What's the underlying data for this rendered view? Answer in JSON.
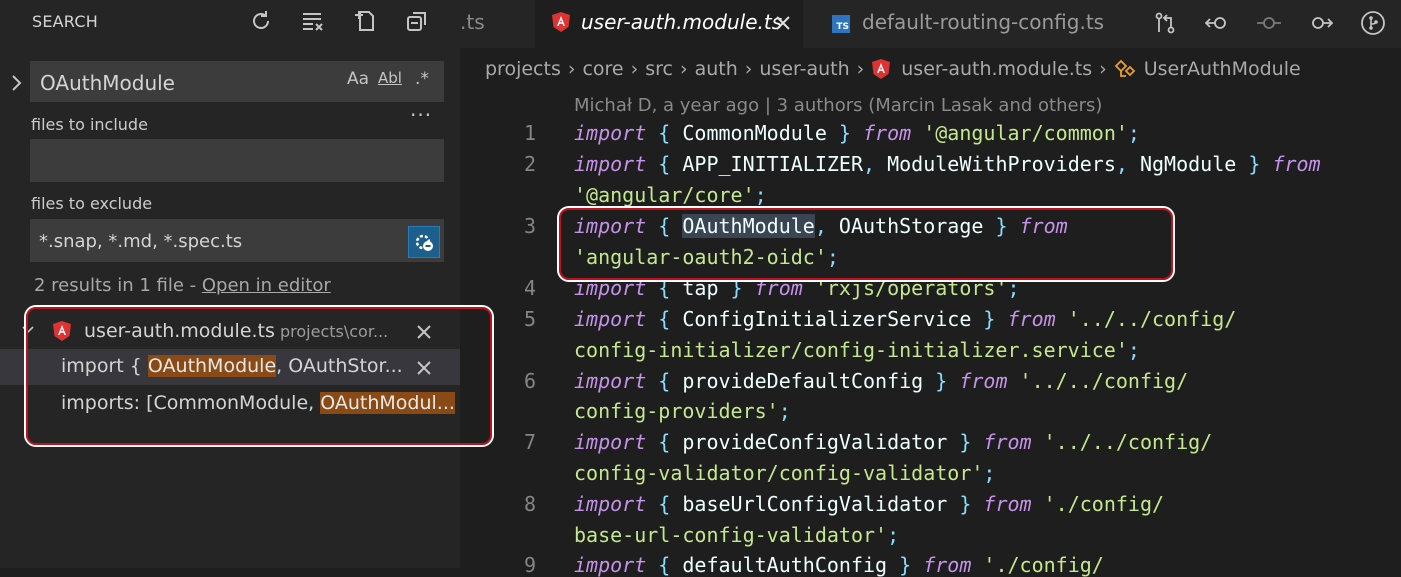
{
  "sidebar": {
    "title": "SEARCH",
    "search_query": "OAuthModule",
    "options": {
      "match_case": "Aa",
      "whole_word": "Abl",
      "regex": ".*"
    },
    "more": "···",
    "include_label": "files to include",
    "include_value": "",
    "exclude_label": "files to exclude",
    "exclude_value": "*.snap, *.md, *.spec.ts",
    "results_summary": "2 results in 1 file - ",
    "open_in_editor": "Open in editor",
    "file": {
      "name": "user-auth.module.ts",
      "path": "projects\\cor..."
    },
    "matches": [
      {
        "before": "import { ",
        "match": "OAuthModule",
        "after": ", OAuthStor..."
      },
      {
        "before": "imports: [CommonModule, ",
        "match": "OAuthModul...",
        "after": ""
      }
    ]
  },
  "tabs": [
    {
      "label": ".ts",
      "active": false
    },
    {
      "label": "user-auth.module.ts",
      "active": true
    },
    {
      "label": "default-routing-config.ts",
      "active": false
    }
  ],
  "breadcrumbs": [
    "projects",
    "core",
    "src",
    "auth",
    "user-auth",
    "user-auth.module.ts",
    "UserAuthModule"
  ],
  "blame": "Michał D, a year ago | 3 authors (Marcin Lasak and others)",
  "line_numbers": [
    "1",
    "2",
    "3",
    "4",
    "5",
    "6",
    "7",
    "8",
    "9"
  ],
  "code": {
    "l1": {
      "kw": "import",
      "open": " { ",
      "id": "CommonModule",
      "close": " } ",
      "from": "from",
      "str": " '@angular/common'",
      "semi": ";"
    },
    "l2": {
      "kw": "import",
      "open": " { ",
      "id": "APP_INITIALIZER",
      "c1": ", ",
      "id2": "ModuleWithProviders",
      "c2": ", ",
      "id3": "NgModule",
      "close": " } ",
      "from": "from"
    },
    "l2b": {
      "str": "'@angular/core'",
      "semi": ";"
    },
    "l3": {
      "kw": "import",
      "open": " { ",
      "id": "OAuthModule",
      "c1": ", ",
      "id2": "OAuthStorage",
      "close": " } ",
      "from": "from"
    },
    "l3b": {
      "str": "'angular-oauth2-oidc'",
      "semi": ";"
    },
    "l4": {
      "kw": "import",
      "open": " { ",
      "id": "tap",
      "close": " } ",
      "from": "from",
      "str": " 'rxjs/operators'",
      "semi": ";"
    },
    "l5": {
      "kw": "import",
      "open": " { ",
      "id": "ConfigInitializerService",
      "close": " } ",
      "from": "from",
      "str": " '../../config/"
    },
    "l5b": {
      "str": "config-initializer/config-initializer.service'",
      "semi": ";"
    },
    "l6": {
      "kw": "import",
      "open": " { ",
      "id": "provideDefaultConfig",
      "close": " } ",
      "from": "from",
      "str": " '../../config/"
    },
    "l6b": {
      "str": "config-providers'",
      "semi": ";"
    },
    "l7": {
      "kw": "import",
      "open": " { ",
      "id": "provideConfigValidator",
      "close": " } ",
      "from": "from",
      "str": " '../../config/"
    },
    "l7b": {
      "str": "config-validator/config-validator'",
      "semi": ";"
    },
    "l8": {
      "kw": "import",
      "open": " { ",
      "id": "baseUrlConfigValidator",
      "close": " } ",
      "from": "from",
      "str": " './config/"
    },
    "l8b": {
      "str": "base-url-config-validator'",
      "semi": ";"
    },
    "l9": {
      "kw": "import",
      "open": " { ",
      "id": "defaultAuthConfig",
      "close": " } ",
      "from": "from",
      "str": " './config/"
    }
  }
}
